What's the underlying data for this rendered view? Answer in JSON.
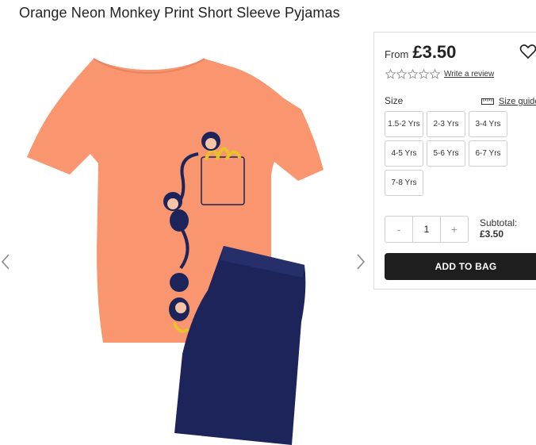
{
  "product": {
    "title": "Orange Neon Monkey Print Short Sleeve Pyjamas"
  },
  "gallery": {
    "prev_icon": "chevron-left-icon",
    "next_icon": "chevron-right-icon",
    "image_alt": "Orange t-shirt with monkey print and navy shorts"
  },
  "pricing": {
    "from_label": "From",
    "price": "£3.50",
    "wishlist_icon": "heart-icon"
  },
  "reviews": {
    "rating": 0,
    "max_rating": 5,
    "link_text": "Write a review"
  },
  "size": {
    "label": "Size",
    "guide_text": "Size guide",
    "guide_icon": "ruler-icon",
    "options": [
      "1.5-2 Yrs",
      "2-3 Yrs",
      "3-4 Yrs",
      "4-5 Yrs",
      "5-6 Yrs",
      "6-7 Yrs",
      "7-8 Yrs"
    ]
  },
  "quantity": {
    "minus": "-",
    "value": "1",
    "plus": "+"
  },
  "subtotal": {
    "label": "Subtotal:",
    "value": "£3.50"
  },
  "cta": {
    "add_to_bag": "ADD TO BAG"
  },
  "colors": {
    "shirt": "#f9956f",
    "shorts": "#1c2459",
    "button": "#1e1e1e"
  }
}
